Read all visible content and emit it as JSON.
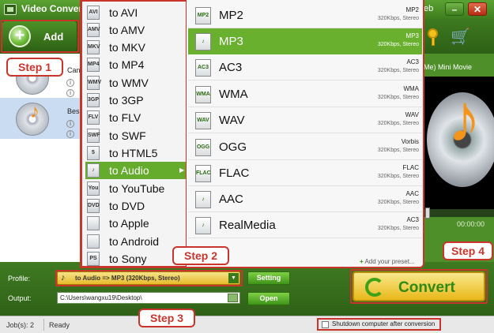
{
  "window": {
    "title": "Video Converter",
    "title_partial_right": "eb",
    "minimize": "–",
    "close": "✕"
  },
  "toolbar": {
    "add_label": "Add",
    "add_icon": "+",
    "cart_icon": "🛒"
  },
  "file_list": {
    "items": [
      {
        "name": "Can"
      },
      {
        "name": "Bes"
      }
    ],
    "info_glyph": "i",
    "bottom_stub": "C"
  },
  "preview": {
    "title": "Me) Mini Movie",
    "time": "00:00:00"
  },
  "category_menu": {
    "items": [
      {
        "icon_label": "AVI",
        "label": "to AVI"
      },
      {
        "icon_label": "AMV",
        "label": "to AMV"
      },
      {
        "icon_label": "MKV",
        "label": "to MKV"
      },
      {
        "icon_label": "MP4",
        "label": "to MP4"
      },
      {
        "icon_label": "WMV",
        "label": "to WMV"
      },
      {
        "icon_label": "3GP",
        "label": "to 3GP"
      },
      {
        "icon_label": "FLV",
        "label": "to FLV"
      },
      {
        "icon_label": "SWF",
        "label": "to SWF"
      },
      {
        "icon_label": "5",
        "label": "to HTML5"
      },
      {
        "icon_label": "♪",
        "label": "to Audio",
        "active": true,
        "arrow": "▶"
      },
      {
        "icon_label": "You",
        "label": "to YouTube"
      },
      {
        "icon_label": "DVD",
        "label": "to DVD"
      },
      {
        "icon_label": "",
        "label": "to Apple"
      },
      {
        "icon_label": "",
        "label": "to Android"
      },
      {
        "icon_label": "PS",
        "label": "to Sony"
      }
    ]
  },
  "format_menu": {
    "items": [
      {
        "icon_label": "MP2",
        "name": "MP2",
        "code": "MP2",
        "rate": "320Kbps, Stereo"
      },
      {
        "icon_label": "♪",
        "name": "MP3",
        "code": "MP3",
        "rate": "320Kbps, Stereo",
        "selected": true
      },
      {
        "icon_label": "AC3",
        "name": "AC3",
        "code": "AC3",
        "rate": "320Kbps, Stereo"
      },
      {
        "icon_label": "WMA",
        "name": "WMA",
        "code": "WMA",
        "rate": "320Kbps, Stereo"
      },
      {
        "icon_label": "WAV",
        "name": "WAV",
        "code": "WAV",
        "rate": "320Kbps, Stereo"
      },
      {
        "icon_label": "OGG",
        "name": "OGG",
        "code": "Vorbis",
        "rate": "320Kbps, Stereo"
      },
      {
        "icon_label": "FLAC",
        "name": "FLAC",
        "code": "FLAC",
        "rate": "320Kbps, Stereo"
      },
      {
        "icon_label": "♪",
        "name": "AAC",
        "code": "AAC",
        "rate": "320Kbps, Stereo"
      },
      {
        "icon_label": "♪",
        "name": "RealMedia",
        "code": "AC3",
        "rate": "320Kbps, Stereo"
      }
    ],
    "add_preset": "Add your preset...",
    "add_preset_icon": "+"
  },
  "settings": {
    "profile_label": "Profile:",
    "profile_value": "to Audio => MP3 (320Kbps, Stereo)",
    "profile_note": "♪",
    "dropdown_arrow": "▼",
    "setting_button": "Setting",
    "output_label": "Output:",
    "output_value": "C:\\Users\\wangxu19\\Desktop\\",
    "open_button": "Open",
    "convert_button": "Convert"
  },
  "status": {
    "jobs": "Job(s): 2",
    "ready": "Ready",
    "shutdown_label": "Shutdown computer after conversion"
  },
  "callouts": {
    "step1": "Step 1",
    "step2": "Step 2",
    "step3": "Step 3",
    "step4": "Step 4"
  },
  "colors": {
    "accent_green": "#65ab2c",
    "callout_red": "#c9352b",
    "convert_gold": "#e9b81a"
  }
}
